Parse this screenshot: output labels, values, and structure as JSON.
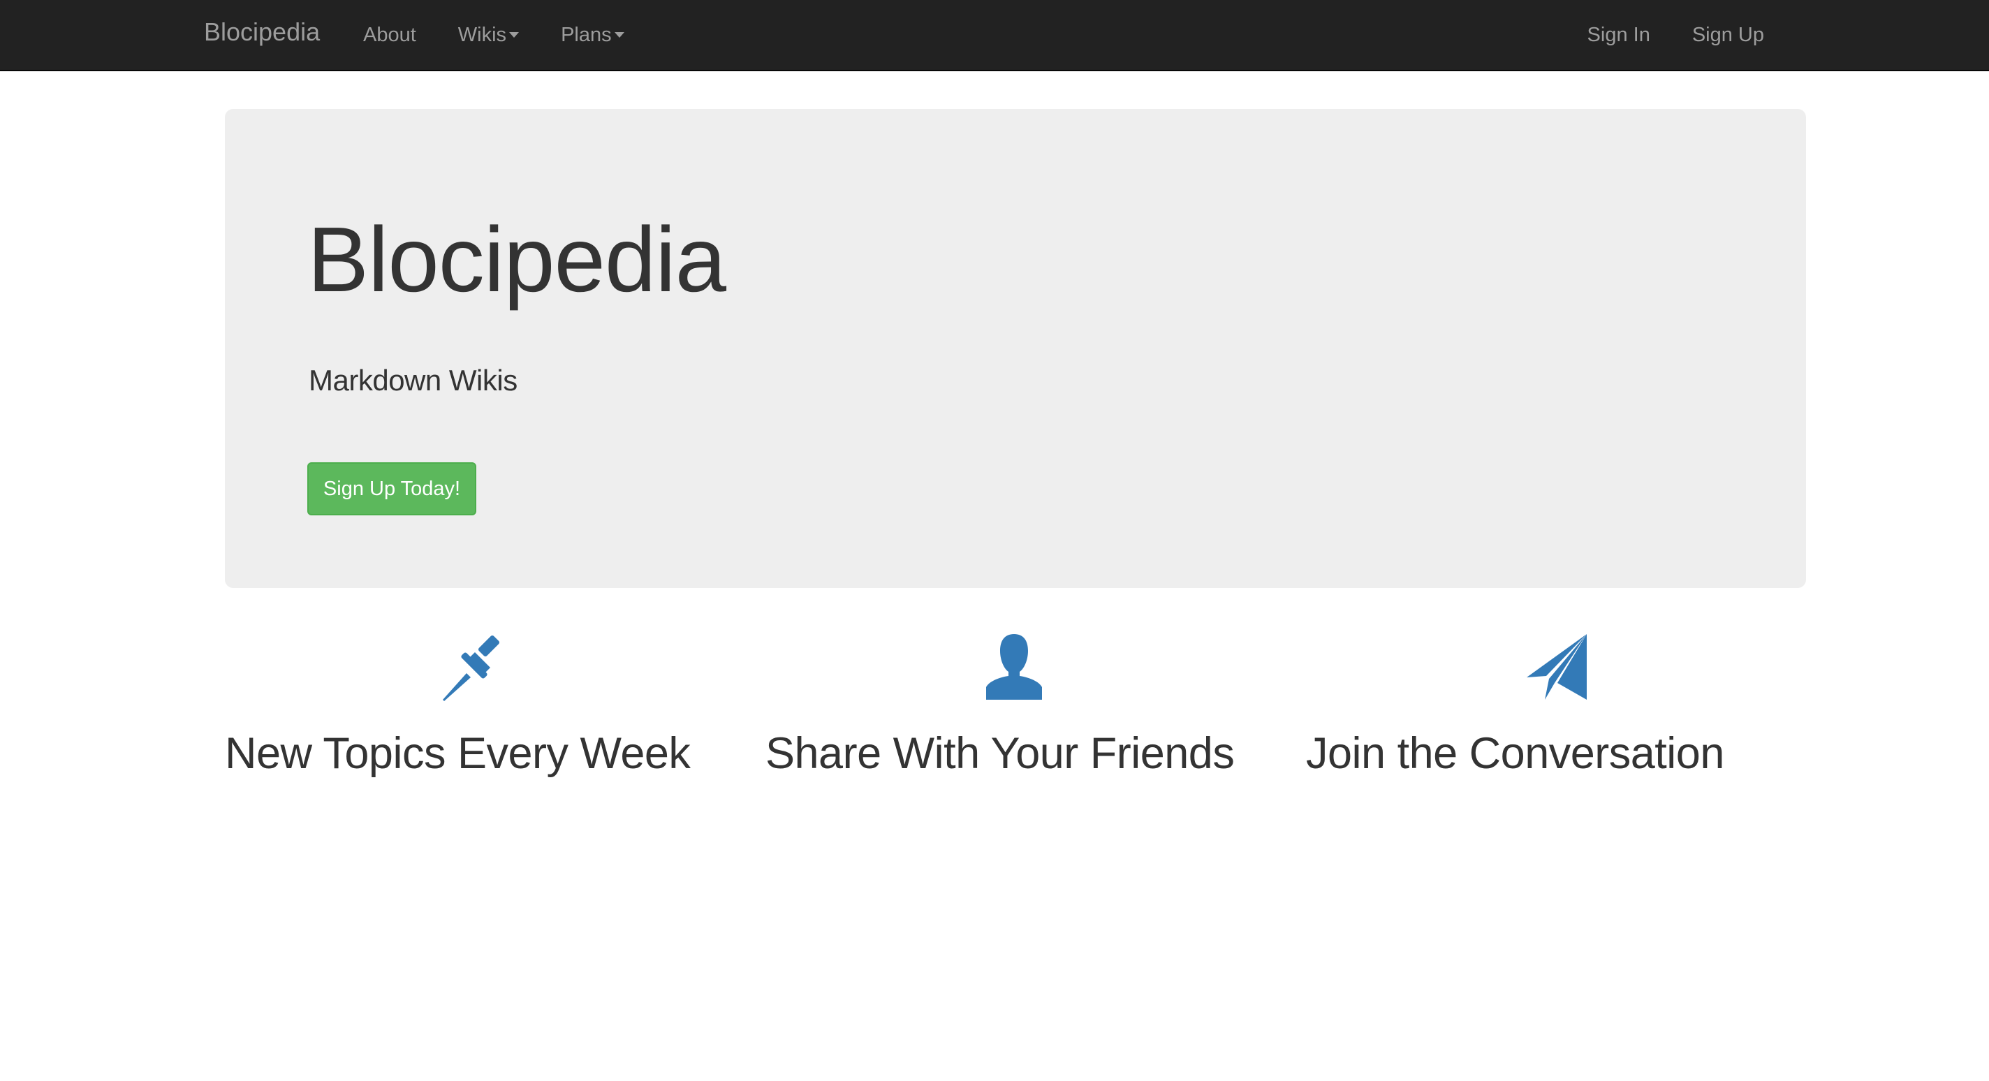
{
  "navbar": {
    "brand": "Blocipedia",
    "left_items": [
      {
        "label": "About",
        "dropdown": false
      },
      {
        "label": "Wikis",
        "dropdown": true
      },
      {
        "label": "Plans",
        "dropdown": true
      }
    ],
    "right_items": [
      {
        "label": "Sign In"
      },
      {
        "label": "Sign Up"
      }
    ]
  },
  "jumbotron": {
    "title": "Blocipedia",
    "subtitle": "Markdown Wikis",
    "button_label": "Sign Up Today!"
  },
  "features": [
    {
      "icon": "pushpin-icon",
      "title": "New Topics Every Week"
    },
    {
      "icon": "user-icon",
      "title": "Share With Your Friends"
    },
    {
      "icon": "send-icon",
      "title": "Join the Conversation"
    }
  ],
  "colors": {
    "navbar_bg": "#222222",
    "nav_text": "#9d9d9d",
    "jumbotron_bg": "#eeeeee",
    "success_button": "#5cb85c",
    "icon_blue": "#337ab7",
    "text": "#333333"
  }
}
